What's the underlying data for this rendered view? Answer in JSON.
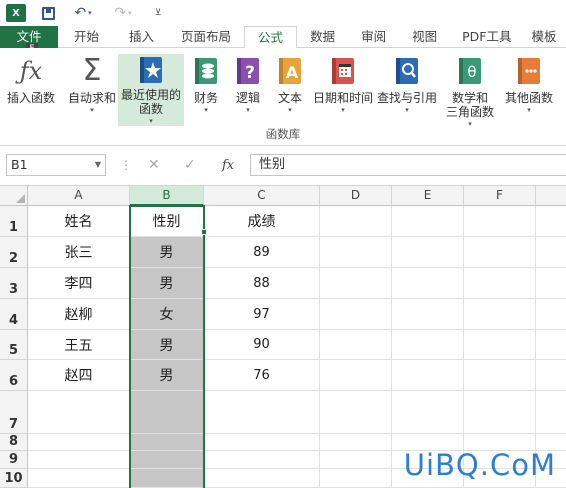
{
  "window": {
    "app_logo": "X",
    "undo_icon": "undo-arrow",
    "redo_icon": "redo-arrow"
  },
  "ribbon_tabs": [
    {
      "label": "文件",
      "active": false
    },
    {
      "label": "开始",
      "active": false
    },
    {
      "label": "插入",
      "active": false
    },
    {
      "label": "页面布局",
      "active": false
    },
    {
      "label": "公式",
      "active": true
    },
    {
      "label": "数据",
      "active": false
    },
    {
      "label": "审阅",
      "active": false
    },
    {
      "label": "视图",
      "active": false
    },
    {
      "label": "PDF工具",
      "active": false
    },
    {
      "label": "模板",
      "active": false
    }
  ],
  "keytip": "F",
  "ribbon": {
    "buttons": [
      {
        "label_line1": "插入函数",
        "label_line2": "",
        "has_caret": false,
        "icon": "fx-icon"
      },
      {
        "label_line1": "自动求和",
        "label_line2": "",
        "has_caret": true,
        "icon": "sigma-icon"
      },
      {
        "label_line1": "最近使用的",
        "label_line2": "函数",
        "has_caret": true,
        "icon": "star-book-icon"
      },
      {
        "label_line1": "财务",
        "label_line2": "",
        "has_caret": true,
        "icon": "coins-book-icon"
      },
      {
        "label_line1": "逻辑",
        "label_line2": "",
        "has_caret": true,
        "icon": "question-book-icon"
      },
      {
        "label_line1": "文本",
        "label_line2": "",
        "has_caret": true,
        "icon": "text-book-icon"
      },
      {
        "label_line1": "日期和时间",
        "label_line2": "",
        "has_caret": true,
        "icon": "calendar-book-icon"
      },
      {
        "label_line1": "查找与引用",
        "label_line2": "",
        "has_caret": true,
        "icon": "search-book-icon"
      },
      {
        "label_line1": "数学和",
        "label_line2": "三角函数",
        "has_caret": true,
        "icon": "theta-book-icon"
      },
      {
        "label_line1": "其他函数",
        "label_line2": "",
        "has_caret": true,
        "icon": "more-book-icon"
      }
    ],
    "group_label": "函数库"
  },
  "formula_bar": {
    "name_box": "B1",
    "fx_label": "fx",
    "value": "性别"
  },
  "sheet": {
    "columns": [
      "A",
      "B",
      "C",
      "D",
      "E",
      "F"
    ],
    "selected_column": "B",
    "rows": [
      "1",
      "2",
      "3",
      "4",
      "5",
      "6",
      "7",
      "8",
      "9",
      "10"
    ],
    "cells": [
      [
        "姓名",
        "性别",
        "成绩"
      ],
      [
        "张三",
        "男",
        "89"
      ],
      [
        "李四",
        "男",
        "88"
      ],
      [
        "赵柳",
        "女",
        "97"
      ],
      [
        "王五",
        "男",
        "90"
      ],
      [
        "赵四",
        "男",
        "76"
      ]
    ]
  },
  "colors": {
    "accent": "#217346",
    "selected_fill": "#c6c6c6",
    "watermark": "#2a7fd4"
  },
  "watermark": "UiBQ.CoM"
}
